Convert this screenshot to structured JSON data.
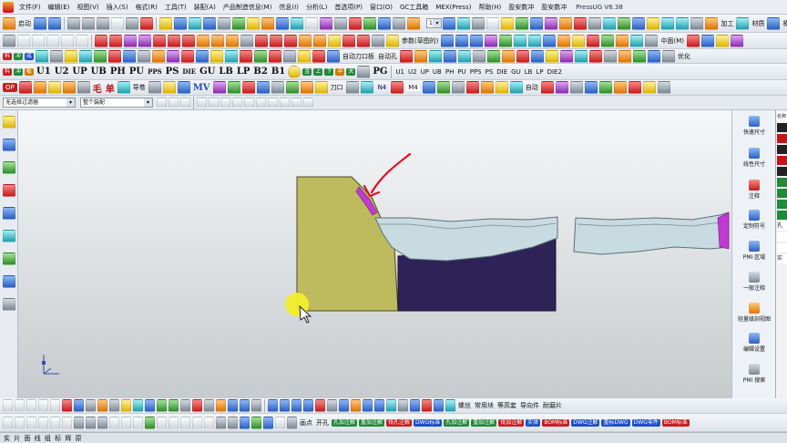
{
  "menubar": {
    "items": [
      "文件(F)",
      "编辑(E)",
      "视图(V)",
      "插入(S)",
      "格式(R)",
      "工具(T)",
      "装配(A)",
      "产品制造信息(M)",
      "信息(I)",
      "分析(L)",
      "首选项(P)",
      "窗口(O)",
      "GC工具箱",
      "MEX(Press)",
      "帮助(H)",
      "盈安数冲",
      "盈安数冲"
    ],
    "app_title": "PressUG V6.38"
  },
  "toolbar1": {
    "start_label": "启动",
    "zoom_value": "150",
    "labels": [
      "加工",
      "材质",
      "横板"
    ]
  },
  "toolbar2": {
    "labels": [
      "中面(M)",
      "参数(草图的)"
    ]
  },
  "toolbar3": {
    "labels": [
      "自动刀口板",
      "自动孔",
      "优化"
    ]
  },
  "toolbar4": {
    "codes": [
      "U1",
      "U2",
      "UP",
      "UB",
      "PH",
      "PU",
      "PPS",
      "PS",
      "DIE",
      "GU",
      "LB",
      "LP",
      "B2",
      "B1",
      "PG"
    ],
    "codes_right": [
      "U1",
      "U2",
      "UP",
      "UB",
      "PH",
      "PU",
      "PPS",
      "PS",
      "DIE",
      "GU",
      "LB",
      "LP",
      "DIE2"
    ]
  },
  "toolbar5": {
    "op": "OP",
    "labels": [
      "毛",
      "单",
      "导卷",
      "N4",
      "M4",
      "刀口",
      "MV",
      "自动"
    ]
  },
  "filterbar": {
    "filter_value": "无选择过滤器",
    "assembly_value": "整个装配"
  },
  "right_panel": {
    "items": [
      {
        "label": "快速尺寸",
        "icon": "quick-dimension-icon"
      },
      {
        "label": "线性尺寸",
        "icon": "linear-dimension-icon"
      },
      {
        "label": "注释",
        "icon": "note-icon"
      },
      {
        "label": "定制符号",
        "icon": "custom-symbol-icon"
      },
      {
        "label": "PMI 区域",
        "icon": "pmi-region-icon"
      },
      {
        "label": "一般注释",
        "icon": "general-note-icon"
      },
      {
        "label": "轻量级剖视图",
        "icon": "section-view-icon"
      },
      {
        "label": "编辑设置",
        "icon": "edit-settings-icon"
      },
      {
        "label": "PMI 搜索",
        "icon": "pmi-search-icon"
      }
    ]
  },
  "far_right": {
    "labels": [
      "名称",
      "孔",
      "实"
    ]
  },
  "bottom_toolbar": {
    "labels": [
      "螺丝",
      "常用块",
      "等高套",
      "导向件",
      "耐磨片"
    ],
    "labels2": [
      "画点",
      "开孔",
      "孔加注解",
      "重加注解",
      "铣孔注解",
      "DWG标准",
      "孔加注解",
      "重加注解",
      "铣加注解",
      "实体",
      "BOM标准",
      "DWG注解",
      "重标DWG",
      "DWG零件",
      "BOM标准"
    ]
  },
  "status_bar": {
    "text": "实 片 面 线 组 标 辉 原"
  },
  "viewport": {
    "colors": {
      "die_block": "#bdbb5e",
      "punch_block": "#2e2357",
      "strip": "#c8dbe0",
      "highlight": "#c03bd0",
      "arrow": "#e0102a",
      "cursor_halo": "#f3ee2a"
    }
  }
}
